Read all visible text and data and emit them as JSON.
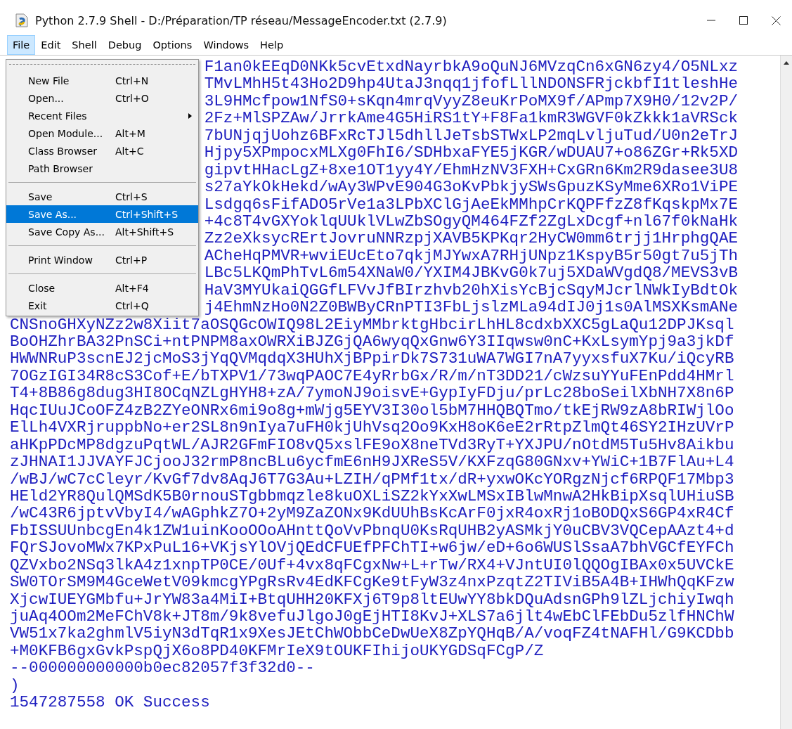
{
  "window": {
    "title": "Python 2.7.9 Shell - D:/Préparation/TP réseau/MessageEncoder.txt (2.7.9)"
  },
  "menu_bar": [
    {
      "label": "File",
      "selected": true
    },
    {
      "label": "Edit",
      "selected": false
    },
    {
      "label": "Shell",
      "selected": false
    },
    {
      "label": "Debug",
      "selected": false
    },
    {
      "label": "Options",
      "selected": false
    },
    {
      "label": "Windows",
      "selected": false
    },
    {
      "label": "Help",
      "selected": false
    }
  ],
  "file_menu": [
    {
      "kind": "tearoff"
    },
    {
      "kind": "item",
      "label": "New File",
      "shortcut": "Ctrl+N",
      "submenu": false,
      "selected": false
    },
    {
      "kind": "item",
      "label": "Open...",
      "shortcut": "Ctrl+O",
      "submenu": false,
      "selected": false
    },
    {
      "kind": "item",
      "label": "Recent Files",
      "submenu": true,
      "selected": false
    },
    {
      "kind": "item",
      "label": "Open Module...",
      "shortcut": "Alt+M",
      "submenu": false,
      "selected": false
    },
    {
      "kind": "item",
      "label": "Class Browser",
      "shortcut": "Alt+C",
      "submenu": false,
      "selected": false
    },
    {
      "kind": "item",
      "label": "Path Browser",
      "submenu": false,
      "selected": false
    },
    {
      "kind": "separator"
    },
    {
      "kind": "item",
      "label": "Save",
      "shortcut": "Ctrl+S",
      "submenu": false,
      "selected": false
    },
    {
      "kind": "item",
      "label": "Save As...",
      "shortcut": "Ctrl+Shift+S",
      "submenu": false,
      "selected": true
    },
    {
      "kind": "item",
      "label": "Save Copy As...",
      "shortcut": "Alt+Shift+S",
      "submenu": false,
      "selected": false
    },
    {
      "kind": "separator"
    },
    {
      "kind": "item",
      "label": "Print Window",
      "shortcut": "Ctrl+P",
      "submenu": false,
      "selected": false
    },
    {
      "kind": "separator"
    },
    {
      "kind": "item",
      "label": "Close",
      "shortcut": "Alt+F4",
      "submenu": false,
      "selected": false
    },
    {
      "kind": "item",
      "label": "Exit",
      "shortcut": "Ctrl+Q",
      "submenu": false,
      "selected": false
    }
  ],
  "shell_output": [
    {
      "text": "F1an0kEEqD0NKk5cvEtxdNayrbkA9oQuNJ6MVzqCn6xGN6zy4/O5NLxz",
      "obscured": true
    },
    {
      "text": "TMvLMhH5t43Ho2D9hp4UtaJ3nqq1jfofLllNDONSFRjckbfI1tleshHe",
      "obscured": true
    },
    {
      "text": "3L9HMcfpow1NfS0+sKqn4mrqVyyZ8euKrPoMX9f/APmp7X9H0/12v2P/",
      "obscured": true
    },
    {
      "text": "2Fz+MlSPZAw/JrrkAme4G5HiRS1tY+F8Fa1kmR3WGVF0kZkkk1aVRSck",
      "obscured": true
    },
    {
      "text": "7bUNjqjUohz6BFxRcTJl5dhllJeTsbSTWxLP2mqLvljuTud/U0n2eTrJ",
      "obscured": true
    },
    {
      "text": "Hjpy5XPmpocxMLXg0FhI6/SDHbxaFYE5jKGR/wDUAU7+o86ZGr+Rk5XD",
      "obscured": true
    },
    {
      "text": "gipvtHHacLgZ+8xe1OT1yy4Y/EhmHzNV3FXH+CxGRn6Km2R9dasee3U8",
      "obscured": true
    },
    {
      "text": "s27aYkOkHekd/wAy3WPvE904G3oKvPbkjySWsGpuzKSyMme6XRo1ViPE",
      "obscured": true
    },
    {
      "text": "Lsdgq6sFifADO5rVe1a3LPbXClGjAeEkMMhpCrKQPFfzZ8fKqskpMx7E",
      "obscured": true
    },
    {
      "text": "+4c8T4vGXYoklqUUklVLwZbSOgyQM464FZf2ZgLxDcgf+nl67f0kNaHk",
      "obscured": true
    },
    {
      "text": "Zz2eXksycRErtJovruNNRzpjXAVB5KPKqr2HyCW0mm6trjj1HrphgQAE",
      "obscured": true
    },
    {
      "text": "ACheHqPMVR+wviEUcEto7qkjMJYwxA7RHjUNpz1KspyB5r50gt7u5jTh",
      "obscured": true
    },
    {
      "text": "LBc5LKQmPhTvL6m54XNaW0/YXIM4JBKvG0k7uj5XDaWVgdQ8/MEVS3vB",
      "obscured": true
    },
    {
      "text": "HaV3MYUkaiQGGfLFVvJfBIrzhvb20hXisYcBjcSqyMJcrlNWkIyBdtOk",
      "obscured": true
    },
    {
      "text": "j4EhmNzHo0N2Z0BWByCRnPTI3FbLjslzMLa94dIJ0j1s0AlMSXKsmANe",
      "obscured": true
    },
    {
      "text": "CNSnoGHXyNZz2w8Xiit7aOSQGcOWIQ98L2EiyMMbrktgHbcirLhHL8cdxbXXC5gLaQu12DPJKsql",
      "obscured": false
    },
    {
      "text": "BoOHZhrBA32PnSCi+ntPNPM8axOWRXiBJZGjQA6wyqQxGnw6Y3IIqwsw0nC+KxLsymYpj9a3jkDf",
      "obscured": false
    },
    {
      "text": "HWWNRuP3scnEJ2jcMoS3jYqQVMqdqX3HUhXjBPpirDk7S731uWA7WGI7nA7yyxsfuX7Ku/iQcyRB",
      "obscured": false
    },
    {
      "text": "7OGzIGI34R8cS3Cof+E/bTXPV1/73wqPAOC7E4yRrbGx/R/m/nT3DD21/cWzsuYYuFEnPdd4HMrl",
      "obscured": false
    },
    {
      "text": "T4+8B86g8dug3HI8OCqNZLgHYH8+zA/7ymoNJ9oisvE+GypIyFDju/prLc28boSeilXbNH7X8n6P",
      "obscured": false
    },
    {
      "text": "HqcIUuJCoOFZ4zB2ZYeONRx6mi9o8g+mWjg5EYV3I30ol5bM7HHQBQTmo/tkEjRW9zA8bRIWjlOo",
      "obscured": false
    },
    {
      "text": "ElLh4VXRjruppbNo+er2SL8n9nIya7uFH0kjUhVsq2Oo9KxH8oK6eE2rRtpZlmQt46SY2IHzUVrP",
      "obscured": false
    },
    {
      "text": "aHKpPDcMP8dgzuPqtWL/AJR2GFmFIO8vQ5xslFE9oX8neTVd3RyT+YXJPU/nOtdM5Tu5Hv8Aikbu",
      "obscured": false
    },
    {
      "text": "zJHNAI1JJVAYFJCjooJ32rmP8ncBLu6ycfmE6nH9JXReS5V/KXFzqG80GNxv+YWiC+1B7FlAu+L4",
      "obscured": false
    },
    {
      "text": "/wBJ/wC7cCleyr/KvGf7dv8AqJ6T7G3Au+LZIH/qPMf1tx/dR+yxwOKcYORgzNjcf6RPQF17Mbp3",
      "obscured": false
    },
    {
      "text": "HEld2YR8QulQMSdK5B0rnouSTgbbmqzle8kuOXLiSZ2kYxXwLMSxIBlwMnwA2HkBipXsqlUHiuSB",
      "obscured": false
    },
    {
      "text": "/wC43R6jptvVbyI4/wAGphkZ7O+2yM9ZaZONx9KdUUhBsKcArF0jxR4oxRj1oBODQxS6GP4xR4Cf",
      "obscured": false
    },
    {
      "text": "FbISSUUnbcgEn4k1ZW1uinKooOOoAHnttQoVvPbnqU0KsRqUHB2yASMkjY0uCBV3VQCepAAzt4+d",
      "obscured": false
    },
    {
      "text": "FQrSJovoMWx7KPxPuL16+VKjsYlOVjQEdCFUEfPFChTI+w6jw/eD+6o6WUSlSsaA7bhVGCfEYFCh",
      "obscured": false
    },
    {
      "text": "QZVxbo2NSq3lkA4z1xnpTP0CE/0Uf+4vx8qFCgxNw+L+rTw/RX4+VJntUI0lQQOgIBAx0x5UVCkE",
      "obscured": false
    },
    {
      "text": "SW0TOrSM9M4GceWetV09kmcgYPgRsRv4EdKFCgKe9tFyW3z4nxPzqtZ2TIViB5A4B+IHWhQqKFzw",
      "obscured": false
    },
    {
      "text": "XjcwIUEYGMbfu+JrYW83a4MiI+BtqUHH20KFXj6T9p8ltEUwYY8bkDQuAdsnGPh9lZLjchiyIwqh",
      "obscured": false
    },
    {
      "text": "juAq4OOm2MeFChV8k+JT8m/9k8vefuJlgoJ0gEjHTI8KvJ+XLS7a6jlt4wEbClFEbDu5zlfHNChW",
      "obscured": false
    },
    {
      "text": "VW51x7ka2ghmlV5iyN3dTqR1x9XesJEtChWObbCeDwUeX8ZpYQHqB/A/voqFZ4tNAFHl/G9KCDbb",
      "obscured": false
    },
    {
      "text": "+M0KFB6gxGvkPspQjX6o8PD40KFMrIeX9tOUKFIhijoUKYGDSqFCgP/Z",
      "obscured": false
    },
    {
      "text": "--000000000000b0ec82057f3f32d0--",
      "obscured": false
    },
    {
      "text": ")",
      "obscured": false
    },
    {
      "text": "1547287558 OK Success",
      "obscured": false
    }
  ]
}
